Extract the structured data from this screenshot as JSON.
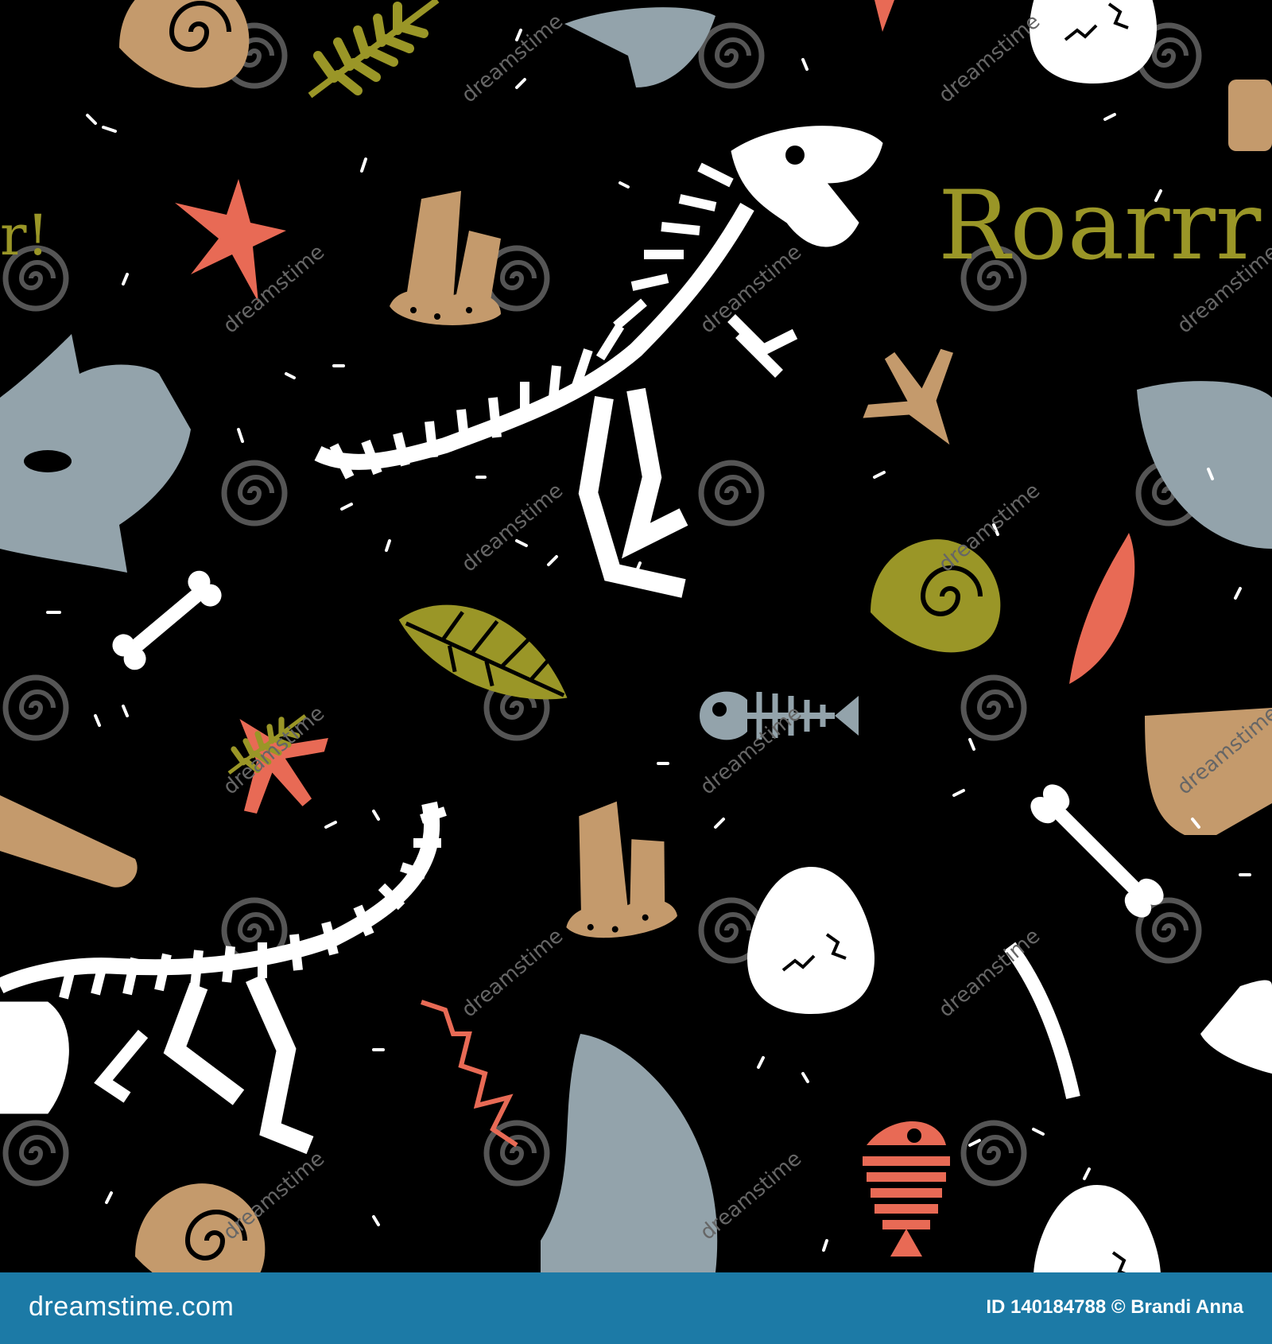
{
  "art": {
    "background": "#000000",
    "palette": {
      "bone": "#ffffff",
      "tan": "#c49a6c",
      "olive": "#9a9627",
      "coral": "#e86a55",
      "slate": "#93a3ab",
      "watermark": "#555555"
    },
    "roar_text": "Roarrr",
    "edge_text": "r!",
    "watermark_text": "dreamstime",
    "motifs": [
      "t-rex-skeleton",
      "raptor-skeleton",
      "fossil-bone",
      "ammonite-shell",
      "fern-leaf",
      "dino-footprint",
      "dino-egg",
      "fish-skeleton",
      "crystal",
      "starfish",
      "triceratops-skull",
      "shark-fin"
    ]
  },
  "footer": {
    "background": "#1c7aa6",
    "logo": "dreamstime.com",
    "credit": "ID 140184788 © Brandi Anna"
  }
}
